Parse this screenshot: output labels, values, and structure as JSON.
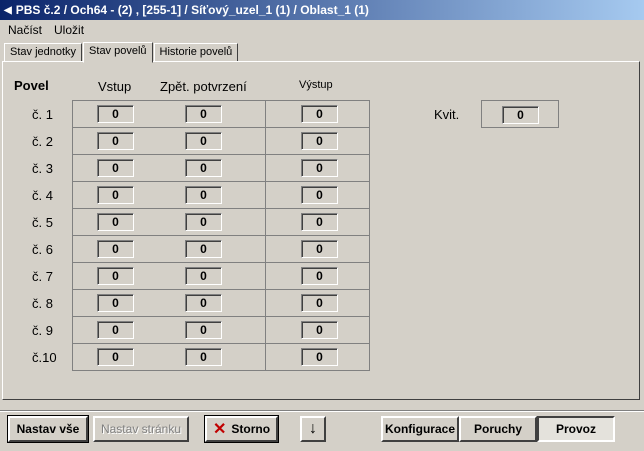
{
  "window": {
    "title": "PBS č.2 / Och64 - (2) , [255-1] / Síťový_uzel_1 (1) / Oblast_1 (1)"
  },
  "menu": {
    "load": "Načíst",
    "save": "Uložit"
  },
  "tabs": [
    {
      "label": "Stav jednotky",
      "active": false
    },
    {
      "label": "Stav povelů",
      "active": true
    },
    {
      "label": "Historie povelů",
      "active": false
    }
  ],
  "columns": {
    "povel": "Povel",
    "vstup": "Vstup",
    "zpet": "Zpět. potvrzení",
    "vystup": "Výstup"
  },
  "rows": [
    {
      "label": "č. 1",
      "vstup": "0",
      "zpet": "0",
      "vystup": "0"
    },
    {
      "label": "č. 2",
      "vstup": "0",
      "zpet": "0",
      "vystup": "0"
    },
    {
      "label": "č. 3",
      "vstup": "0",
      "zpet": "0",
      "vystup": "0"
    },
    {
      "label": "č. 4",
      "vstup": "0",
      "zpet": "0",
      "vystup": "0"
    },
    {
      "label": "č. 5",
      "vstup": "0",
      "zpet": "0",
      "vystup": "0"
    },
    {
      "label": "č. 6",
      "vstup": "0",
      "zpet": "0",
      "vystup": "0"
    },
    {
      "label": "č. 7",
      "vstup": "0",
      "zpet": "0",
      "vystup": "0"
    },
    {
      "label": "č. 8",
      "vstup": "0",
      "zpet": "0",
      "vystup": "0"
    },
    {
      "label": "č. 9",
      "vstup": "0",
      "zpet": "0",
      "vystup": "0"
    },
    {
      "label": "č.10",
      "vstup": "0",
      "zpet": "0",
      "vystup": "0"
    }
  ],
  "kvit": {
    "label": "Kvit.",
    "value": "0"
  },
  "buttons": {
    "set_all": "Nastav vše",
    "set_page": "Nastav stránku",
    "cancel": "Storno",
    "config": "Konfigurace",
    "faults": "Poruchy",
    "operation": "Provoz"
  },
  "icons": {
    "cancel": "red-x-icon",
    "down": "down-arrow-icon",
    "title": "app-icon"
  },
  "colors": {
    "titlebar_start": "#0a246a",
    "titlebar_end": "#a6caf0",
    "face": "#d4d0c8",
    "cancel_icon": "#c00000"
  }
}
